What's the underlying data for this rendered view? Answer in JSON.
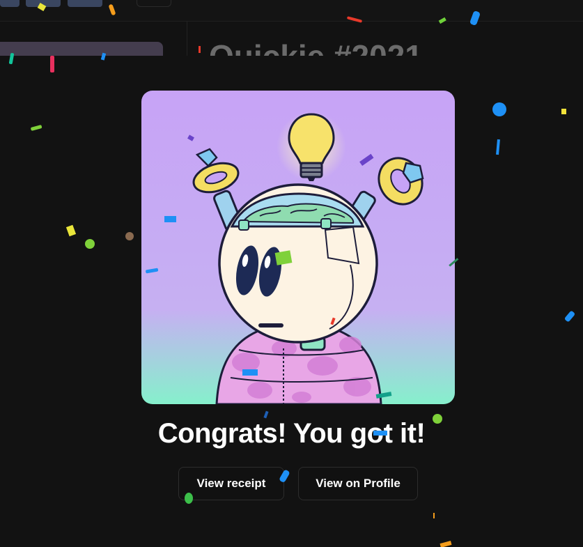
{
  "background_page": {
    "title_partial": "Quickie #2021"
  },
  "modal": {
    "headline": "Congrats! You got it!",
    "buttons": {
      "view_receipt": "View receipt",
      "view_on_profile": "View on Profile"
    },
    "artwork": {
      "subject": "robot-character-with-lightbulb-and-pink-camo-puffer",
      "gradient_top": "#c9a6f5",
      "gradient_bottom": "#86f0cc"
    }
  },
  "colors": {
    "background": "#121212",
    "text": "#ffffff",
    "button_border": "#2d2d2d"
  }
}
